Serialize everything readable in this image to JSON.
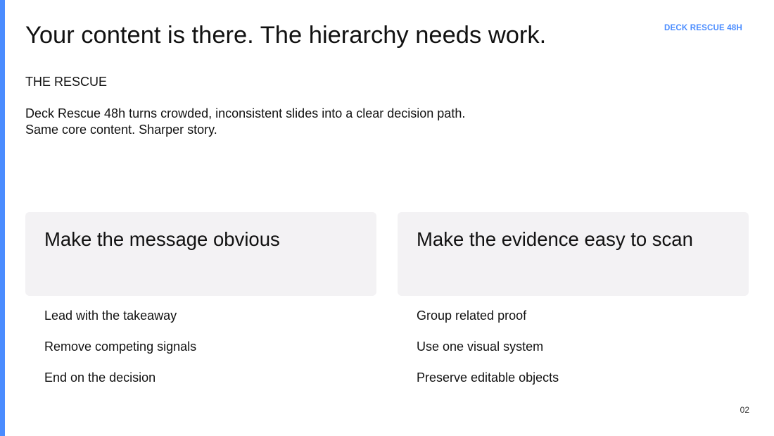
{
  "brand_label": "DECK RESCUE 48H",
  "title": "Your content is there. The hierarchy needs work.",
  "kicker": "THE RESCUE",
  "lede": {
    "line1": "Deck Rescue 48h turns crowded, inconsistent slides into a clear decision path.",
    "line2": "Same core content. Sharper story."
  },
  "columns": [
    {
      "card_title": "Make the message obvious",
      "items": [
        "Lead with the takeaway",
        "Remove competing signals",
        "End on the decision"
      ]
    },
    {
      "card_title": "Make the evidence easy to scan",
      "items": [
        "Group related proof",
        "Use one visual system",
        "Preserve editable objects"
      ]
    }
  ],
  "page_number": "02",
  "colors": {
    "accent": "#4a8cff",
    "card_background": "#f3f2f4",
    "text": "#111111"
  }
}
